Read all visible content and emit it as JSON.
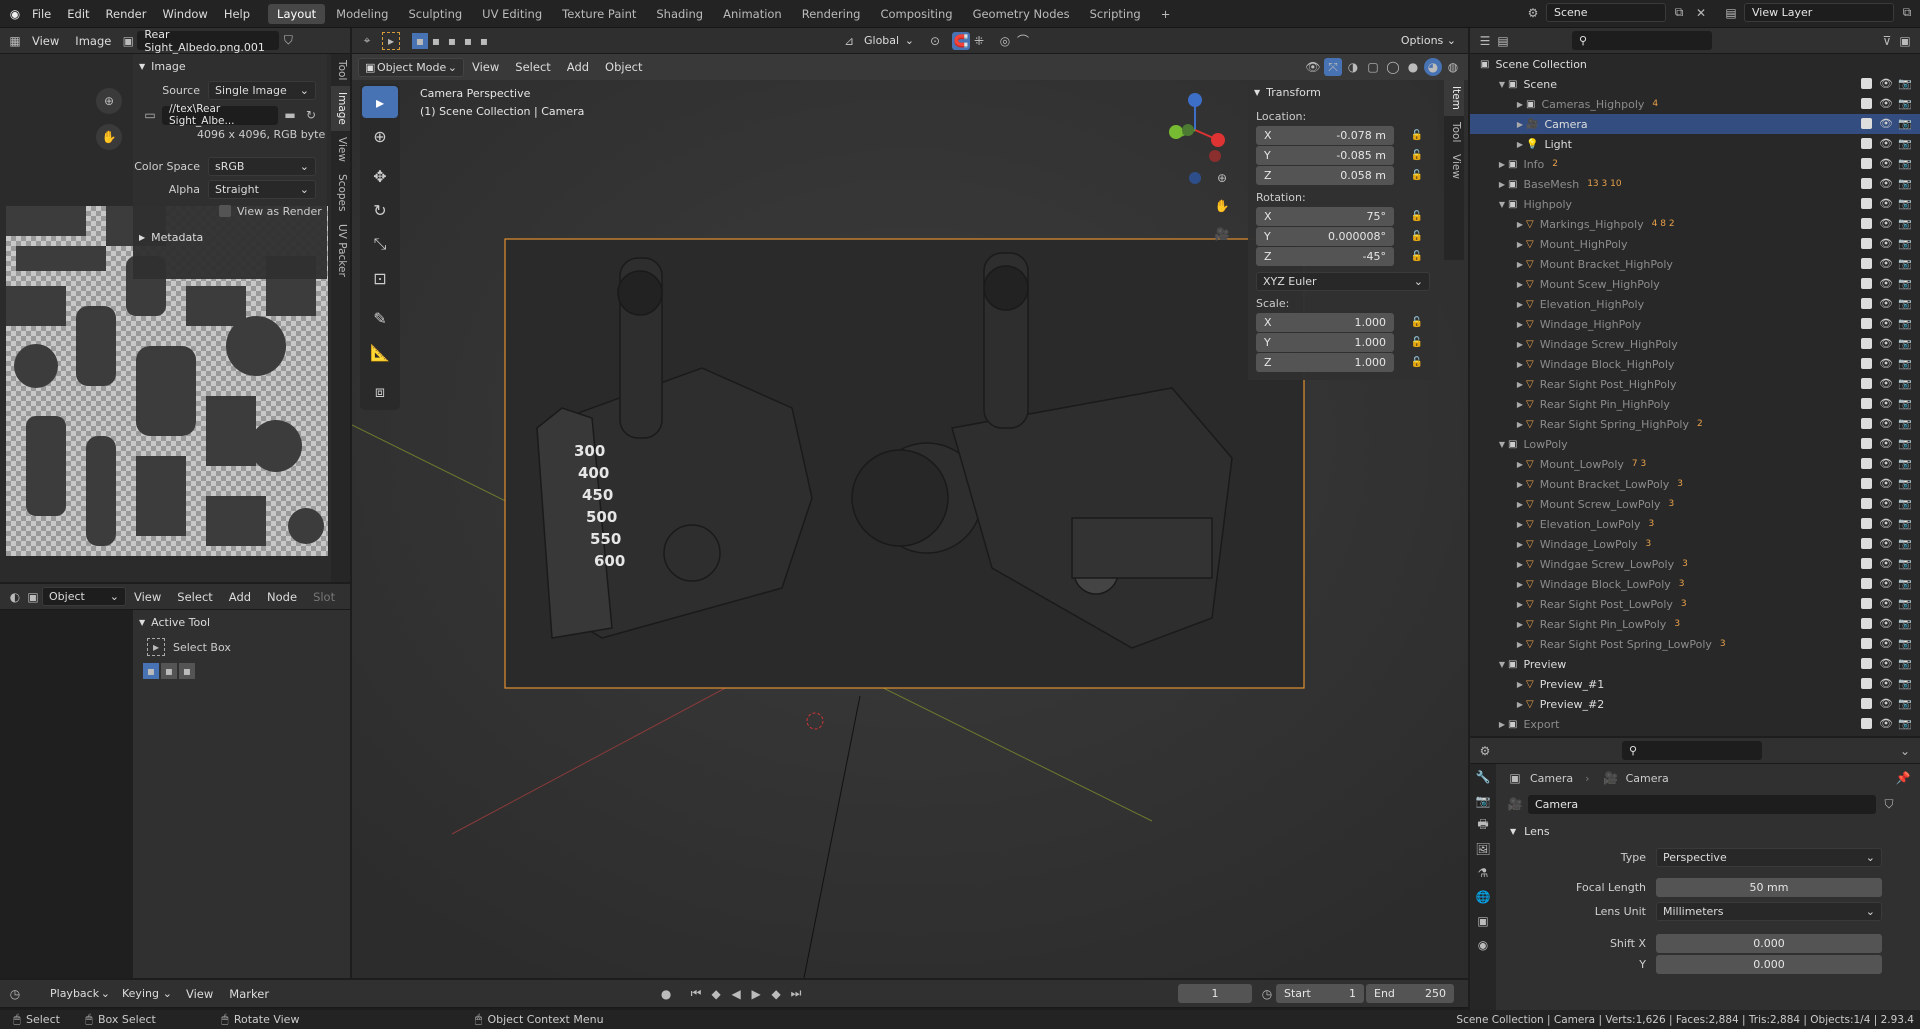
{
  "topbar": {
    "menus": [
      "File",
      "Edit",
      "Render",
      "Window",
      "Help"
    ],
    "workspaces": [
      "Layout",
      "Modeling",
      "Sculpting",
      "UV Editing",
      "Texture Paint",
      "Shading",
      "Animation",
      "Rendering",
      "Compositing",
      "Geometry Nodes",
      "Scripting"
    ],
    "active_workspace": "Layout",
    "add_tab": "+",
    "scene_name": "Scene",
    "view_layer": "View Layer"
  },
  "image_editor": {
    "view": "View",
    "image": "Image",
    "image_name": "Rear Sight_Albedo.png.001",
    "panel_title": "Image",
    "source_label": "Source",
    "source_value": "Single Image",
    "filepath": "//tex\\Rear Sight_Albe...",
    "info": "4096 x 4096,  RGB byte",
    "colorspace_label": "Color Space",
    "colorspace_value": "sRGB",
    "alpha_label": "Alpha",
    "alpha_value": "Straight",
    "view_as_render": "View as Render",
    "metadata": "Metadata",
    "side_tabs": [
      "Tool",
      "Image",
      "View",
      "Scopes",
      "UV Packer"
    ]
  },
  "node_editor": {
    "type": "Object",
    "view": "View",
    "select": "Select",
    "add": "Add",
    "node": "Node",
    "slot": "Slot",
    "panel_title": "Active Tool",
    "tool_name": "Select Box"
  },
  "viewport": {
    "mode": "Object Mode",
    "view": "View",
    "select": "Select",
    "add": "Add",
    "object": "Object",
    "orientation": "Global",
    "options": "Options",
    "overlay_title": "Camera Perspective",
    "overlay_sub": "(1) Scene Collection | Camera",
    "dial_numbers": [
      "300",
      "400",
      "450",
      "500",
      "550",
      "600"
    ],
    "side_tabs": [
      "Item",
      "Tool",
      "View"
    ]
  },
  "transform": {
    "title": "Transform",
    "location_label": "Location:",
    "location": [
      {
        "axis": "X",
        "value": "-0.078 m"
      },
      {
        "axis": "Y",
        "value": "-0.085 m"
      },
      {
        "axis": "Z",
        "value": "0.058 m"
      }
    ],
    "rotation_label": "Rotation:",
    "rotation": [
      {
        "axis": "X",
        "value": "75°"
      },
      {
        "axis": "Y",
        "value": "0.000008°"
      },
      {
        "axis": "Z",
        "value": "-45°"
      }
    ],
    "euler": "XYZ Euler",
    "scale_label": "Scale:",
    "scale": [
      {
        "axis": "X",
        "value": "1.000"
      },
      {
        "axis": "Y",
        "value": "1.000"
      },
      {
        "axis": "Z",
        "value": "1.000"
      }
    ]
  },
  "outliner": {
    "root": "Scene Collection",
    "rows": [
      {
        "name": "Scene",
        "indent": 1,
        "kind": "coll",
        "expanded": true,
        "dim": false,
        "badge": ""
      },
      {
        "name": "Cameras_Highpoly",
        "indent": 2,
        "kind": "coll",
        "dim": true,
        "badge": "4"
      },
      {
        "name": "Camera",
        "indent": 2,
        "kind": "cam",
        "dim": false,
        "sel": true,
        "badge": ""
      },
      {
        "name": "Light",
        "indent": 2,
        "kind": "light",
        "dim": false,
        "badge": ""
      },
      {
        "name": "Info",
        "indent": 1,
        "kind": "coll",
        "dim": true,
        "badge": "2"
      },
      {
        "name": "BaseMesh",
        "indent": 1,
        "kind": "coll",
        "dim": true,
        "badge": "13 3 10"
      },
      {
        "name": "Highpoly",
        "indent": 1,
        "kind": "coll",
        "expanded": true,
        "dim": true,
        "badge": ""
      },
      {
        "name": "Markings_Highpoly",
        "indent": 2,
        "kind": "obj",
        "dim": true,
        "badge": "4 8 2"
      },
      {
        "name": "Mount_HighPoly",
        "indent": 2,
        "kind": "obj",
        "dim": true,
        "badge": ""
      },
      {
        "name": "Mount Bracket_HighPoly",
        "indent": 2,
        "kind": "obj",
        "dim": true,
        "badge": ""
      },
      {
        "name": "Mount Scew_HighPoly",
        "indent": 2,
        "kind": "obj",
        "dim": true,
        "badge": ""
      },
      {
        "name": "Elevation_HighPoly",
        "indent": 2,
        "kind": "obj",
        "dim": true,
        "badge": ""
      },
      {
        "name": "Windage_HighPoly",
        "indent": 2,
        "kind": "obj",
        "dim": true,
        "badge": ""
      },
      {
        "name": "Windage Screw_HighPoly",
        "indent": 2,
        "kind": "obj",
        "dim": true,
        "badge": ""
      },
      {
        "name": "Windage Block_HighPoly",
        "indent": 2,
        "kind": "obj",
        "dim": true,
        "badge": ""
      },
      {
        "name": "Rear Sight Post_HighPoly",
        "indent": 2,
        "kind": "obj",
        "dim": true,
        "badge": ""
      },
      {
        "name": "Rear Sight Pin_HighPoly",
        "indent": 2,
        "kind": "obj",
        "dim": true,
        "badge": ""
      },
      {
        "name": "Rear Sight Spring_HighPoly",
        "indent": 2,
        "kind": "obj",
        "dim": true,
        "badge": "2"
      },
      {
        "name": "LowPoly",
        "indent": 1,
        "kind": "coll",
        "expanded": true,
        "dim": true,
        "badge": ""
      },
      {
        "name": "Mount_LowPoly",
        "indent": 2,
        "kind": "obj",
        "dim": true,
        "badge": "7 3"
      },
      {
        "name": "Mount Bracket_LowPoly",
        "indent": 2,
        "kind": "obj",
        "dim": true,
        "badge": "3"
      },
      {
        "name": "Mount Screw_LowPoly",
        "indent": 2,
        "kind": "obj",
        "dim": true,
        "badge": "3"
      },
      {
        "name": "Elevation_LowPoly",
        "indent": 2,
        "kind": "obj",
        "dim": true,
        "badge": "3"
      },
      {
        "name": "Windage_LowPoly",
        "indent": 2,
        "kind": "obj",
        "dim": true,
        "badge": "3"
      },
      {
        "name": "Windgae Screw_LowPoly",
        "indent": 2,
        "kind": "obj",
        "dim": true,
        "badge": "3"
      },
      {
        "name": "Windage Block_LowPoly",
        "indent": 2,
        "kind": "obj",
        "dim": true,
        "badge": "3"
      },
      {
        "name": "Rear Sight Post_LowPoly",
        "indent": 2,
        "kind": "obj",
        "dim": true,
        "badge": "3"
      },
      {
        "name": "Rear Sight Pin_LowPoly",
        "indent": 2,
        "kind": "obj",
        "dim": true,
        "badge": "3"
      },
      {
        "name": "Rear Sight Post Spring_LowPoly",
        "indent": 2,
        "kind": "obj",
        "dim": true,
        "badge": "3"
      },
      {
        "name": "Preview",
        "indent": 1,
        "kind": "coll",
        "expanded": true,
        "dim": false,
        "badge": ""
      },
      {
        "name": "Preview_#1",
        "indent": 2,
        "kind": "obj",
        "dim": false,
        "badge": ""
      },
      {
        "name": "Preview_#2",
        "indent": 2,
        "kind": "obj",
        "dim": false,
        "badge": ""
      },
      {
        "name": "Export",
        "indent": 1,
        "kind": "coll",
        "dim": true,
        "badge": ""
      }
    ]
  },
  "properties": {
    "breadcrumb_1": "Camera",
    "breadcrumb_2": "Camera",
    "data_name": "Camera",
    "lens_title": "Lens",
    "type_label": "Type",
    "type_value": "Perspective",
    "focal_label": "Focal Length",
    "focal_value": "50 mm",
    "lens_unit_label": "Lens Unit",
    "lens_unit_value": "Millimeters",
    "shiftx_label": "Shift X",
    "shiftx_value": "0.000",
    "shifty_label": "Y",
    "shifty_value": "0.000"
  },
  "timeline": {
    "playback": "Playback",
    "keying": "Keying",
    "view": "View",
    "marker": "Marker",
    "current_frame": "1",
    "start_label": "Start",
    "start_value": "1",
    "end_label": "End",
    "end_value": "250"
  },
  "status": {
    "select": "Select",
    "box_select": "Box Select",
    "rotate_view": "Rotate View",
    "context_menu": "Object Context Menu",
    "stats": "Scene Collection | Camera | Verts:1,626 | Faces:2,884 | Tris:2,884 | Objects:1/4 | 2.93.4"
  }
}
